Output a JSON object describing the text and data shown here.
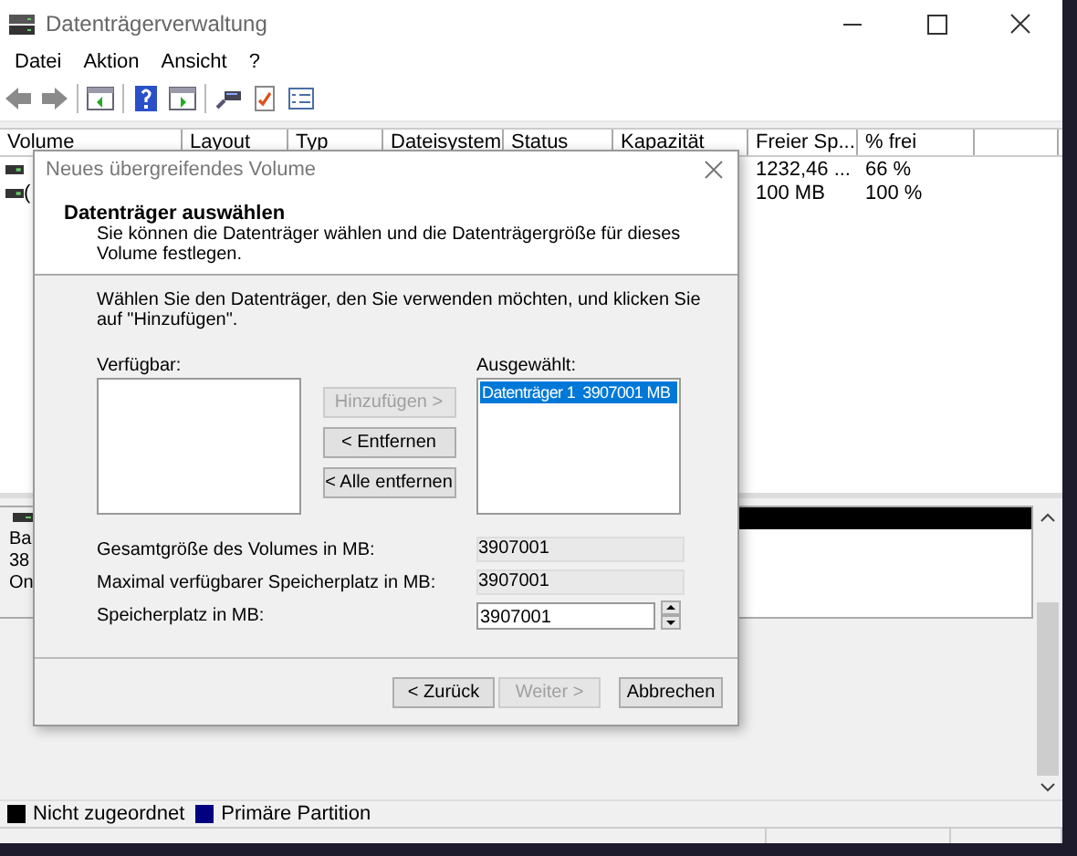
{
  "window": {
    "title": "Datenträgerverwaltung"
  },
  "menu": [
    "Datei",
    "Aktion",
    "Ansicht",
    "?"
  ],
  "table": {
    "columns": [
      "Volume",
      "Layout",
      "Typ",
      "Dateisystem",
      "Status",
      "Kapazität",
      "Freier Sp...",
      "% frei"
    ],
    "rows": [
      {
        "free": "1232,46 ...",
        "percent_free": "66 %"
      },
      {
        "volume": "(",
        "free": "100 MB",
        "percent_free": "100 %"
      }
    ]
  },
  "disk": {
    "label_lines": [
      "Ba",
      "38",
      "On"
    ]
  },
  "legend": [
    {
      "label": "Nicht zugeordnet",
      "color": "#000000"
    },
    {
      "label": "Primäre Partition",
      "color": "#000080"
    }
  ],
  "dialog": {
    "title": "Neues übergreifendes Volume",
    "heading": "Datenträger auswählen",
    "description": "Sie können die Datenträger wählen und die Datenträgergröße für dieses Volume festlegen.",
    "instruction": "Wählen Sie den Datenträger, den Sie verwenden möchten, und klicken Sie auf \"Hinzufügen\".",
    "available": {
      "label": "Verfügbar:"
    },
    "chosen": {
      "label": "Ausgewählt:",
      "items": [
        {
          "name": "Datenträger 1",
          "size": "3907001 MB",
          "selected": true
        }
      ]
    },
    "move_buttons": [
      {
        "label": "Hinzufügen >",
        "disabled": true
      },
      {
        "label": "< Entfernen",
        "disabled": false
      },
      {
        "label": "< Alle entfernen",
        "disabled": false
      }
    ],
    "fields": [
      {
        "kind": "readonly",
        "label": "Gesamtgröße des Volumes in MB:",
        "value": "3907001"
      },
      {
        "kind": "readonly",
        "label": "Maximal verfügbarer Speicherplatz in MB:",
        "value": "3907001"
      },
      {
        "kind": "spinner",
        "label": "Speicherplatz in MB:",
        "value": "3907001"
      }
    ],
    "buttons": [
      {
        "label": "< Zurück",
        "disabled": false
      },
      {
        "label": "Weiter >",
        "disabled": true
      },
      {
        "label": "Abbrechen",
        "disabled": false
      }
    ]
  }
}
